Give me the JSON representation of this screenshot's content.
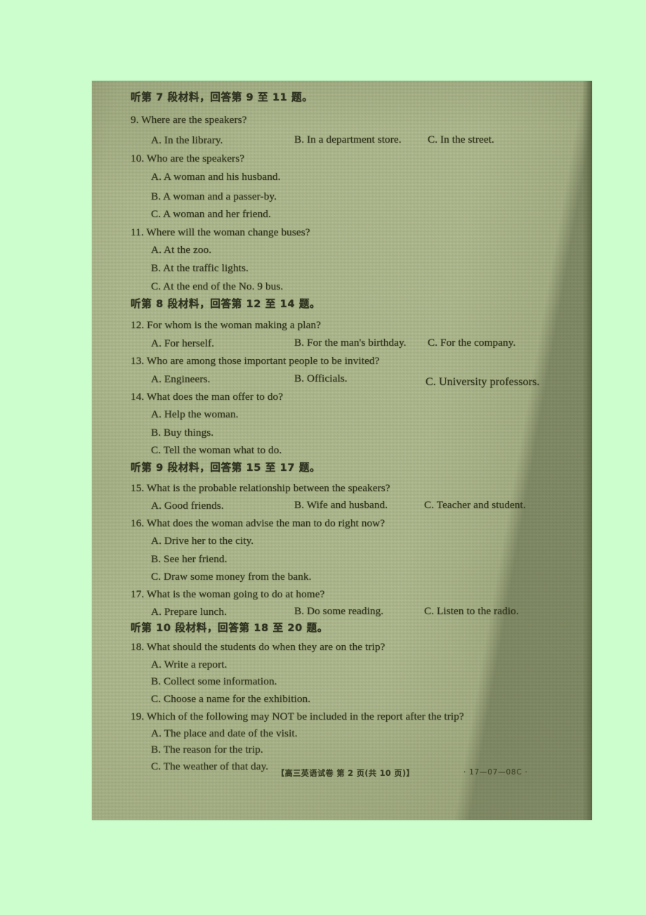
{
  "document": {
    "type": "scanned-exam-page",
    "subject_footer": "【高三英语试卷  第 2 页(共 10 页)】",
    "paper_code": "· 17—07—08C ·",
    "background_color": "#ccfdcc",
    "paper_color": "#b5bf96",
    "ink_color": "#33371f"
  },
  "sections": [
    {
      "heading": "听第 7 段材料，回答第 9 至 11 题。",
      "questions": [
        {
          "number": "9.",
          "prompt": "Where are the speakers?",
          "layout": "inline",
          "options": [
            {
              "label": "A.",
              "text": "In the library."
            },
            {
              "label": "B.",
              "text": "In a department store."
            },
            {
              "label": "C.",
              "text": "In the street."
            }
          ]
        },
        {
          "number": "10.",
          "prompt": "Who are the speakers?",
          "layout": "stacked",
          "options": [
            {
              "label": "A.",
              "text": "A woman and his husband."
            },
            {
              "label": "B.",
              "text": "A woman and a passer-by."
            },
            {
              "label": "C.",
              "text": "A woman and her friend."
            }
          ]
        },
        {
          "number": "11.",
          "prompt": "Where will the woman change buses?",
          "layout": "stacked",
          "options": [
            {
              "label": "A.",
              "text": "At the zoo."
            },
            {
              "label": "B.",
              "text": "At the traffic lights."
            },
            {
              "label": "C.",
              "text": "At the end of the No. 9 bus."
            }
          ]
        }
      ]
    },
    {
      "heading": "听第 8 段材料，回答第 12 至 14 题。",
      "questions": [
        {
          "number": "12.",
          "prompt": "For whom is the woman making a plan?",
          "layout": "inline",
          "options": [
            {
              "label": "A.",
              "text": "For herself."
            },
            {
              "label": "B.",
              "text": "For the man's birthday."
            },
            {
              "label": "C.",
              "text": "For the company."
            }
          ]
        },
        {
          "number": "13.",
          "prompt": "Who are among those important people to be invited?",
          "layout": "inline",
          "options": [
            {
              "label": "A.",
              "text": "Engineers."
            },
            {
              "label": "B.",
              "text": "Officials."
            },
            {
              "label": "C.",
              "text": "University professors."
            }
          ]
        },
        {
          "number": "14.",
          "prompt": "What does the man offer to do?",
          "layout": "stacked",
          "options": [
            {
              "label": "A.",
              "text": "Help the woman."
            },
            {
              "label": "B.",
              "text": "Buy things."
            },
            {
              "label": "C.",
              "text": "Tell the woman what to do."
            }
          ]
        }
      ]
    },
    {
      "heading": "听第 9 段材料，回答第 15 至 17 题。",
      "questions": [
        {
          "number": "15.",
          "prompt": "What is the probable relationship between the speakers?",
          "layout": "inline",
          "options": [
            {
              "label": "A.",
              "text": "Good friends."
            },
            {
              "label": "B.",
              "text": "Wife and husband."
            },
            {
              "label": "C.",
              "text": "Teacher and student."
            }
          ]
        },
        {
          "number": "16.",
          "prompt": "What does the woman advise the man to do right now?",
          "layout": "stacked",
          "options": [
            {
              "label": "A.",
              "text": "Drive her to the city."
            },
            {
              "label": "B.",
              "text": "See her friend."
            },
            {
              "label": "C.",
              "text": "Draw some money from the bank."
            }
          ]
        },
        {
          "number": "17.",
          "prompt": "What is the woman going to do at home?",
          "layout": "inline",
          "options": [
            {
              "label": "A.",
              "text": "Prepare lunch."
            },
            {
              "label": "B.",
              "text": "Do some reading."
            },
            {
              "label": "C.",
              "text": "Listen to the radio."
            }
          ]
        }
      ]
    },
    {
      "heading": "听第 10 段材料，回答第 18 至 20 题。",
      "questions": [
        {
          "number": "18.",
          "prompt": "What should the students do when they are on the trip?",
          "layout": "stacked",
          "options": [
            {
              "label": "A.",
              "text": "Write a report."
            },
            {
              "label": "B.",
              "text": "Collect some information."
            },
            {
              "label": "C.",
              "text": "Choose a name for the exhibition."
            }
          ]
        },
        {
          "number": "19.",
          "prompt": "Which of the following may NOT be included in the report after the trip?",
          "layout": "stacked",
          "options": [
            {
              "label": "A.",
              "text": "The place and date of the visit."
            },
            {
              "label": "B.",
              "text": "The reason for the trip."
            },
            {
              "label": "C.",
              "text": "The weather of that day."
            }
          ]
        }
      ]
    },
    "__lines__",
    {
      "l0": "听第 7 段材料，回答第 9 至 11 题。",
      "l1": "9. Where are the speakers?",
      "l2a": "A. In the library.",
      "l2b": "B. In a department store.",
      "l2c": "C. In the street.",
      "l3": "10. Who are the speakers?",
      "l4": "A. A woman and his husband.",
      "l5": "B. A woman and a passer-by.",
      "l6": "C. A woman and her friend.",
      "l7": "11. Where will the woman change buses?",
      "l8": "A. At the zoo.",
      "l9": "B. At the traffic lights.",
      "l10": "C. At the end of the No. 9 bus.",
      "l11": "听第 8 段材料，回答第 12 至 14 题。",
      "l12": "12. For whom is the woman making a plan?",
      "l13a": "A. For herself.",
      "l13b": "B. For the man's birthday.",
      "l13c": "C. For the company.",
      "l14": "13. Who are among those important people to be invited?",
      "l15a": "A. Engineers.",
      "l15b": "B. Officials.",
      "l15c": "C. University professors.",
      "l16": "14. What does the man offer to do?",
      "l17": "A. Help the woman.",
      "l18": "B. Buy things.",
      "l19": "C. Tell the woman what to do.",
      "l20": "听第 9 段材料，回答第 15 至 17 题。",
      "l21": "15. What is the probable relationship between the speakers?",
      "l22a": "A. Good friends.",
      "l22b": "B. Wife and husband.",
      "l22c": "C. Teacher and student.",
      "l23": "16. What does the woman advise the man to do right now?",
      "l24": "A. Drive her to the city.",
      "l25": "B. See her friend.",
      "l26": "C. Draw some money from the bank.",
      "l27": "17. What is the woman going to do at home?",
      "l28a": "A. Prepare lunch.",
      "l28b": "B. Do some reading.",
      "l28c": "C. Listen to the radio.",
      "l29": "听第 10 段材料，回答第 18 至 20 题。",
      "l30": "18. What should the students do when they are on the trip?",
      "l31": "A. Write a report.",
      "l32": "B. Collect some information.",
      "l33": "C. Choose a name for the exhibition.",
      "l34": "19. Which of the following may NOT be included in the report after the trip?",
      "l35": "A. The place and date of the visit.",
      "l36": "B. The reason for the trip.",
      "l37": "C. The weather of that day."
    }
  ],
  "lines": {
    "l0": "听第 7 段材料，回答第 9 至 11 题。",
    "l1": "9. Where are the speakers?",
    "l2a": "A. In the library.",
    "l2b": "B. In a department store.",
    "l2c": "C. In the street.",
    "l3": "10. Who are the speakers?",
    "l4": "A. A woman and his husband.",
    "l5": "B. A woman and a passer-by.",
    "l6": "C. A woman and her friend.",
    "l7": "11. Where will the woman change buses?",
    "l8": "A. At the zoo.",
    "l9": "B. At the traffic lights.",
    "l10": "C. At the end of the No. 9 bus.",
    "l11": "听第 8 段材料，回答第 12 至 14 题。",
    "l12": "12. For whom is the woman making a plan?",
    "l13a": "A. For herself.",
    "l13b": "B. For the man's birthday.",
    "l13c": "C. For the company.",
    "l14": "13. Who are among those important people to be invited?",
    "l15a": "A. Engineers.",
    "l15b": "B. Officials.",
    "l15c": "C. University professors.",
    "l16": "14. What does the man offer to do?",
    "l17": "A. Help the woman.",
    "l18": "B. Buy things.",
    "l19": "C. Tell the woman what to do.",
    "l20": "听第 9 段材料，回答第 15 至 17 题。",
    "l21": "15. What is the probable relationship between the speakers?",
    "l22a": "A. Good friends.",
    "l22b": "B. Wife and husband.",
    "l22c": "C. Teacher and student.",
    "l23": "16. What does the woman advise the man to do right now?",
    "l24": "A. Drive her to the city.",
    "l25": "B. See her friend.",
    "l26": "C. Draw some money from the bank.",
    "l27": "17. What is the woman going to do at home?",
    "l28a": "A. Prepare lunch.",
    "l28b": "B. Do some reading.",
    "l28c": "C. Listen to the radio.",
    "l29": "听第 10 段材料，回答第 18 至 20 题。",
    "l30": "18. What should the students do when they are on the trip?",
    "l31": "A. Write a report.",
    "l32": "B. Collect some information.",
    "l33": "C. Choose a name for the exhibition.",
    "l34": "19. Which of the following may NOT be included in the report after the trip?",
    "l35": "A. The place and date of the visit.",
    "l36": "B. The reason for the trip.",
    "l37": "C. The weather of that day."
  },
  "footer": {
    "center": "【高三英语试卷  第 2 页(共 10 页)】",
    "code": "· 17—07—08C ·"
  }
}
